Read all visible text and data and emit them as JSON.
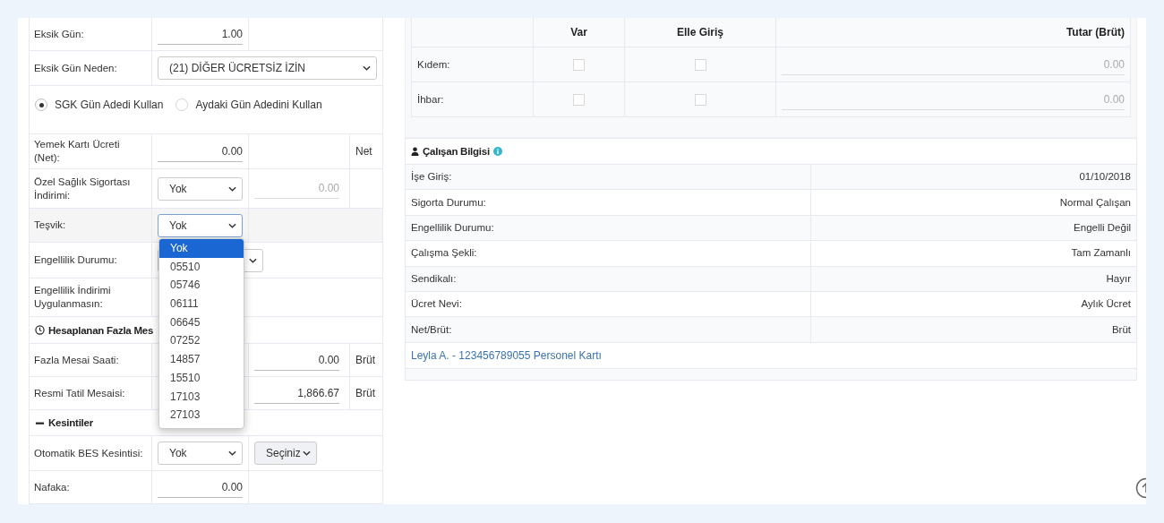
{
  "form": {
    "rows": [
      {
        "kind": "input",
        "label": "Eksik Gün:",
        "value": "1.00"
      },
      {
        "kind": "select_wide",
        "label": "Eksik Gün Neden:",
        "value": "(21) DİĞER ÜCRETSİZ İZİN"
      },
      {
        "kind": "radios",
        "options": [
          {
            "label": "SGK Gün Adedi Kullan",
            "selected": true
          },
          {
            "label": "Aydaki Gün Adedini Kullan",
            "selected": false
          }
        ]
      },
      {
        "kind": "input",
        "label": "Yemek Kartı Ücreti (Net):",
        "value": "0.00",
        "unit": "Net"
      },
      {
        "kind": "select_amount",
        "label": "Özel Sağlık Sigortası İndirimi:",
        "value": "Yok",
        "amount": "0.00"
      },
      {
        "kind": "select",
        "label": "Teşvik:",
        "value": "Yok",
        "focused": true
      },
      {
        "kind": "select_hidden",
        "label": "Engellilik Durumu:"
      },
      {
        "kind": "label",
        "label": "Engellilik İndirimi Uygulanmasın:"
      },
      {
        "kind": "section",
        "title": "Hesaplanan Fazla Mes"
      },
      {
        "kind": "amount",
        "label": "Fazla Mesai Saati:",
        "amount": "0.00",
        "unit": "Brüt"
      },
      {
        "kind": "amount",
        "label": "Resmi Tatil Mesaisi:",
        "amount": "1,866.67",
        "unit": "Brüt"
      },
      {
        "kind": "section",
        "title": "Kesintiler"
      },
      {
        "kind": "double_select",
        "label": "Otomatik BES Kesintisi:",
        "value": "Yok",
        "second": "Seçiniz"
      },
      {
        "kind": "input",
        "label": "Nafaka:",
        "value": "0.00"
      }
    ],
    "dropdown": {
      "options": [
        {
          "label": "Yok",
          "selected": true
        },
        {
          "label": "05510",
          "selected": false
        },
        {
          "label": "05746",
          "selected": false
        },
        {
          "label": "06111",
          "selected": false
        },
        {
          "label": "06645",
          "selected": false
        },
        {
          "label": "07252",
          "selected": false
        },
        {
          "label": "14857",
          "selected": false
        },
        {
          "label": "15510",
          "selected": false
        },
        {
          "label": "17103",
          "selected": false
        },
        {
          "label": "27103",
          "selected": false
        }
      ]
    }
  },
  "severance": {
    "columns": [
      "Var",
      "Elle Giriş",
      "Tutar (Brüt)"
    ],
    "rows": [
      {
        "label": "Kıdem:",
        "checked": false,
        "manual": false,
        "amount": "0.00"
      },
      {
        "label": "İhbar:",
        "checked": false,
        "manual": false,
        "amount": "0.00"
      }
    ]
  },
  "employee": {
    "title": "Çalışan Bilgisi",
    "rows": [
      {
        "label": "İşe Giriş:",
        "value": "01/10/2018"
      },
      {
        "label": "Sigorta Durumu:",
        "value": "Normal Çalışan"
      },
      {
        "label": "Engellilik Durumu:",
        "value": "Engelli Değil"
      },
      {
        "label": "Çalışma Şekli:",
        "value": "Tam Zamanlı"
      },
      {
        "label": "Sendikalı:",
        "value": "Hayır"
      },
      {
        "label": "Ücret Nevi:",
        "value": "Aylık Ücret"
      },
      {
        "label": "Net/Brüt:",
        "value": "Brüt"
      }
    ],
    "link": "Leyla A. - 123456789055 Personel Kartı"
  }
}
